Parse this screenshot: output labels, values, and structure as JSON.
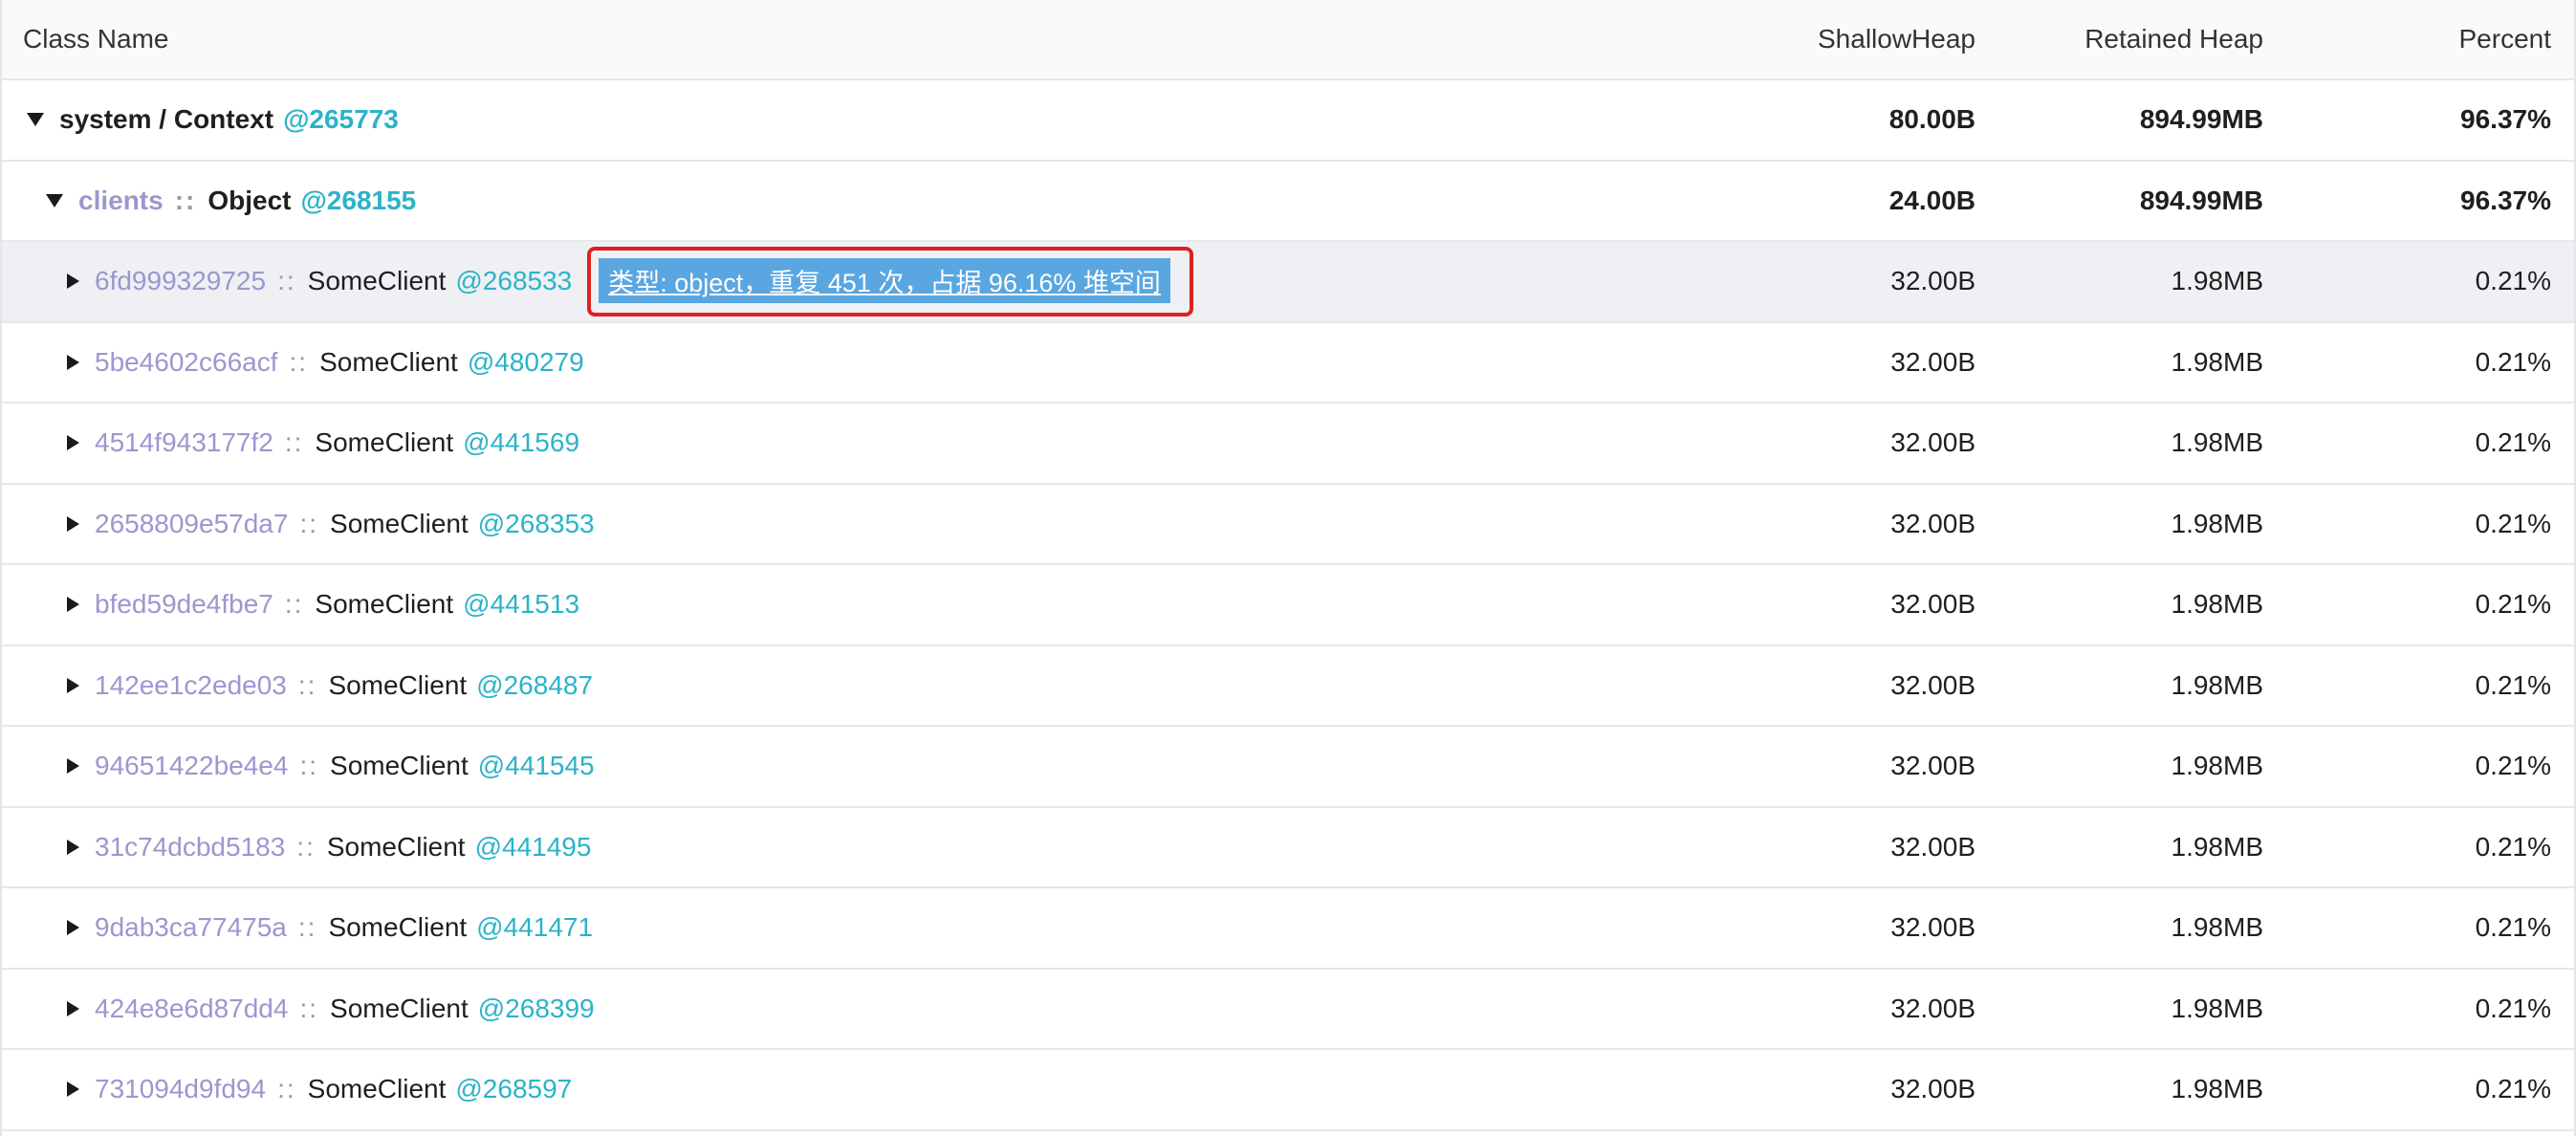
{
  "header": {
    "class_name": "Class Name",
    "shallow_heap": "ShallowHeap",
    "retained_heap": "Retained Heap",
    "percent": "Percent"
  },
  "root": {
    "label": "system / Context",
    "address": "@265773",
    "shallow": "80.00B",
    "retained": "894.99MB",
    "percent": "96.37%",
    "expanded": true
  },
  "clients": {
    "key": "clients",
    "separator": "::",
    "type": "Object",
    "address": "@268155",
    "shallow": "24.00B",
    "retained": "894.99MB",
    "percent": "96.37%",
    "expanded": true
  },
  "tooltip": "类型: object，重复 451 次，占据 96.16% 堆空间",
  "rows": [
    {
      "key": "6fd999329725",
      "sep": "::",
      "cls": "SomeClient",
      "addr": "@268533",
      "shallow": "32.00B",
      "retained": "1.98MB",
      "percent": "0.21%"
    },
    {
      "key": "5be4602c66acf",
      "sep": "::",
      "cls": "SomeClient",
      "addr": "@480279",
      "shallow": "32.00B",
      "retained": "1.98MB",
      "percent": "0.21%"
    },
    {
      "key": "4514f943177f2",
      "sep": "::",
      "cls": "SomeClient",
      "addr": "@441569",
      "shallow": "32.00B",
      "retained": "1.98MB",
      "percent": "0.21%"
    },
    {
      "key": "2658809e57da7",
      "sep": "::",
      "cls": "SomeClient",
      "addr": "@268353",
      "shallow": "32.00B",
      "retained": "1.98MB",
      "percent": "0.21%"
    },
    {
      "key": "bfed59de4fbe7",
      "sep": "::",
      "cls": "SomeClient",
      "addr": "@441513",
      "shallow": "32.00B",
      "retained": "1.98MB",
      "percent": "0.21%"
    },
    {
      "key": "142ee1c2ede03",
      "sep": "::",
      "cls": "SomeClient",
      "addr": "@268487",
      "shallow": "32.00B",
      "retained": "1.98MB",
      "percent": "0.21%"
    },
    {
      "key": "94651422be4e4",
      "sep": "::",
      "cls": "SomeClient",
      "addr": "@441545",
      "shallow": "32.00B",
      "retained": "1.98MB",
      "percent": "0.21%"
    },
    {
      "key": "31c74dcbd5183",
      "sep": "::",
      "cls": "SomeClient",
      "addr": "@441495",
      "shallow": "32.00B",
      "retained": "1.98MB",
      "percent": "0.21%"
    },
    {
      "key": "9dab3ca77475a",
      "sep": "::",
      "cls": "SomeClient",
      "addr": "@441471",
      "shallow": "32.00B",
      "retained": "1.98MB",
      "percent": "0.21%"
    },
    {
      "key": "424e8e6d87dd4",
      "sep": "::",
      "cls": "SomeClient",
      "addr": "@268399",
      "shallow": "32.00B",
      "retained": "1.98MB",
      "percent": "0.21%"
    },
    {
      "key": "731094d9fd94",
      "sep": "::",
      "cls": "SomeClient",
      "addr": "@268597",
      "shallow": "32.00B",
      "retained": "1.98MB",
      "percent": "0.21%"
    }
  ],
  "colors": {
    "key": "#9b97cf",
    "address": "#2bb3c8",
    "tooltip_bg": "#5aa6e0",
    "highlight_border": "#e02020",
    "row_highlight": "#eef0f4"
  },
  "icons": {
    "expanded": "caret-down-icon",
    "collapsed": "caret-right-icon"
  }
}
